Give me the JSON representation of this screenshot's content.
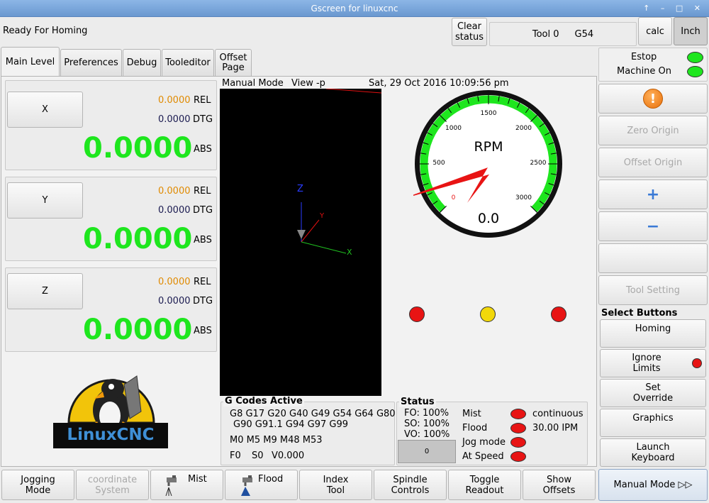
{
  "window": {
    "title": "Gscreen for linuxcnc",
    "controls": "↑ – □ ✕"
  },
  "status_msg": "Ready For Homing",
  "header": {
    "clear_status": "Clear\nstatus",
    "tool": "Tool 0",
    "work_offset": "G54",
    "calc": "calc",
    "units": "Inch"
  },
  "tabs": [
    "Main Level",
    "Preferences",
    "Debug",
    "Tooleditor",
    "Offset\nPage"
  ],
  "dro": [
    {
      "axis": "X",
      "rel": "0.0000",
      "rel_label": "REL",
      "dtg": "0.0000",
      "dtg_label": "DTG",
      "abs": "0.0000",
      "abs_label": "ABS"
    },
    {
      "axis": "Y",
      "rel": "0.0000",
      "rel_label": "REL",
      "dtg": "0.0000",
      "dtg_label": "DTG",
      "abs": "0.0000",
      "abs_label": "ABS"
    },
    {
      "axis": "Z",
      "rel": "0.0000",
      "rel_label": "REL",
      "dtg": "0.0000",
      "dtg_label": "DTG",
      "abs": "0.0000",
      "abs_label": "ABS"
    }
  ],
  "logo": {
    "text": "LinuxCNC"
  },
  "graphics": {
    "mode": "Manual Mode",
    "view": "View -p",
    "datetime": "Sat, 29 Oct 2016   10:09:56 pm",
    "axis_z": "Z",
    "axis_y": "Y",
    "axis_x": "X"
  },
  "gauge": {
    "label": "RPM",
    "value": "0.0",
    "ticks": [
      "0",
      "500",
      "1000",
      "1500",
      "2000",
      "2500",
      "3000"
    ],
    "rpm": 0
  },
  "gcodes": {
    "title": "G Codes Active",
    "g_line1": "G8 G17 G20 G40 G49 G54 G64 G80",
    "g_line2": "G90 G91.1 G94 G97 G99",
    "m_line": "M0 M5 M9 M48 M53",
    "f": "F0",
    "s": "S0",
    "v": "V0.000"
  },
  "status": {
    "title": "Status",
    "fo": "FO: 100%",
    "so": "SO: 100%",
    "vo": "VO: 100%",
    "counter": "0",
    "mist": "Mist",
    "flood": "Flood",
    "jog_mode": "Jog mode",
    "at_speed": "At Speed",
    "jog_type": "continuous",
    "jog_rate": "30.00 IPM"
  },
  "right_panel": {
    "estop": "Estop",
    "machine_on": "Machine On",
    "zero_origin": "Zero Origin",
    "offset_origin": "Offset Origin",
    "plus": "+",
    "minus": "−",
    "tool_setting": "Tool Setting",
    "select_buttons": "Select Buttons",
    "homing": "Homing",
    "ignore_limits": "Ignore\nLimits",
    "set_override": "Set\nOverride",
    "graphics": "Graphics",
    "launch_keyboard": "Launch\nKeyboard"
  },
  "bottom": {
    "jogging_mode": "Jogging\nMode",
    "coordinate_system": "coordinate\nSystem",
    "mist": "Mist",
    "flood": "Flood",
    "index_tool": "Index\nTool",
    "spindle_controls": "Spindle\nControls",
    "toggle_readout": "Toggle\nReadout",
    "show_offsets": "Show\nOffsets",
    "manual_mode": "Manual Mode ▷▷"
  },
  "colors": {
    "dro_green": "#1ee61e",
    "rel_orange": "#e08a00",
    "led_red": "#e81414",
    "led_green": "#1ee61e",
    "led_yellow": "#f2d80a"
  }
}
